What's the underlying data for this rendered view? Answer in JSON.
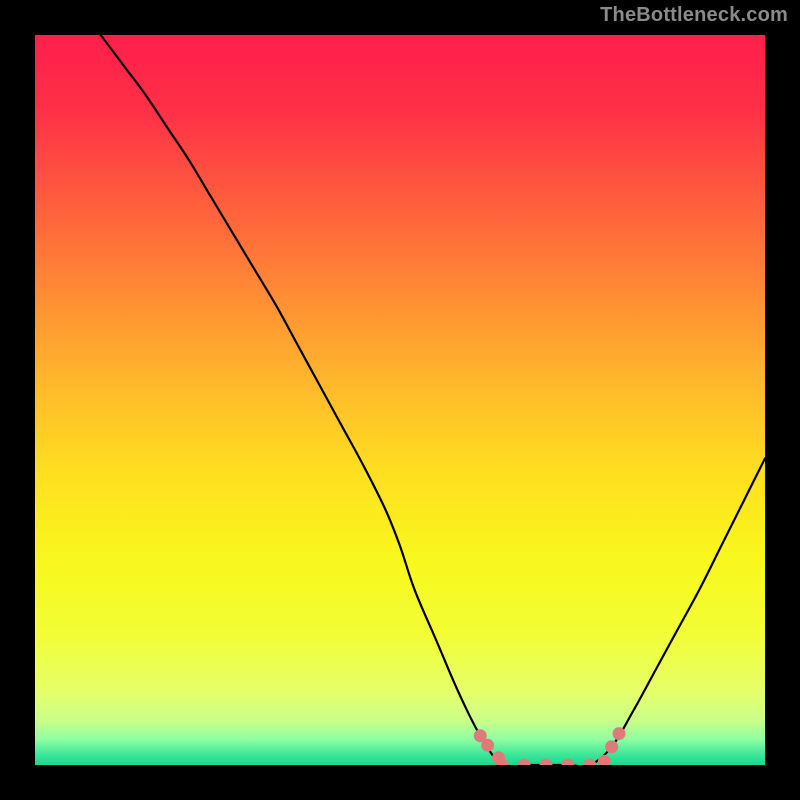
{
  "watermark": "TheBottleneck.com",
  "chart_data": {
    "type": "line",
    "title": "",
    "xlabel": "",
    "ylabel": "",
    "xlim": [
      0,
      100
    ],
    "ylim": [
      0,
      100
    ],
    "grid": false,
    "series": [
      {
        "name": "bottleneck-curve",
        "x": [
          9,
          12,
          15,
          18,
          21,
          24,
          27,
          30,
          33,
          36,
          39,
          42,
          45,
          48,
          50,
          52,
          55,
          58,
          61,
          64,
          67,
          70,
          73,
          76,
          79,
          82,
          85,
          88,
          91,
          94,
          97,
          100
        ],
        "values": [
          100,
          96,
          92,
          87.5,
          83,
          78,
          73,
          68,
          63,
          57.5,
          52,
          46.5,
          41,
          35,
          30,
          24,
          17,
          10,
          4,
          0,
          0,
          0,
          0,
          0,
          2.5,
          7.5,
          13,
          18.5,
          24,
          30,
          36,
          42
        ]
      }
    ],
    "markers": {
      "name": "highlighted-points",
      "color": "#dd7b78",
      "x": [
        61,
        62,
        63.5,
        64,
        67,
        70,
        73,
        76,
        78,
        79,
        80
      ],
      "values": [
        4,
        2.7,
        1,
        0,
        0,
        0,
        0,
        0,
        0.5,
        2.5,
        4.3
      ]
    },
    "background_gradient": {
      "stops": [
        {
          "offset": 0.0,
          "color": "#ff1f4a"
        },
        {
          "offset": 0.1,
          "color": "#ff2f47"
        },
        {
          "offset": 0.22,
          "color": "#ff5a3e"
        },
        {
          "offset": 0.35,
          "color": "#ff8a35"
        },
        {
          "offset": 0.48,
          "color": "#ffb92b"
        },
        {
          "offset": 0.6,
          "color": "#ffdf20"
        },
        {
          "offset": 0.72,
          "color": "#f8f81c"
        },
        {
          "offset": 0.82,
          "color": "#f2fd35"
        },
        {
          "offset": 0.9,
          "color": "#e6ff6a"
        },
        {
          "offset": 0.94,
          "color": "#c8ff8a"
        },
        {
          "offset": 0.965,
          "color": "#8effa3"
        },
        {
          "offset": 0.985,
          "color": "#3fe79a"
        },
        {
          "offset": 1.0,
          "color": "#17d98e"
        }
      ]
    }
  }
}
